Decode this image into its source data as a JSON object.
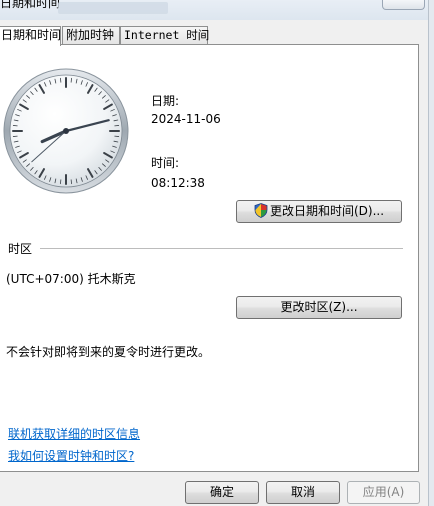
{
  "window": {
    "title": "日期和时间"
  },
  "tabs": [
    {
      "label": "日期和时间",
      "active": true
    },
    {
      "label": "附加时钟",
      "active": false
    },
    {
      "label": "Internet 时间",
      "active": false
    }
  ],
  "clock": {
    "time_shown": "08:12:38"
  },
  "date_section": {
    "date_label": "日期:",
    "date_value": "2024-11-06",
    "time_label": "时间:",
    "time_value": "08:12:38",
    "change_datetime_button": "更改日期和时间(D)..."
  },
  "timezone_section": {
    "header": "时区",
    "current_zone": "(UTC+07:00) 托木斯克",
    "change_zone_button": "更改时区(Z)...",
    "dst_note": "不会针对即将到来的夏令时进行更改。"
  },
  "links": {
    "online_info": "联机获取详细的时区信息",
    "how_to": "我如何设置时钟和时区?"
  },
  "footer": {
    "ok": "确定",
    "cancel": "取消",
    "apply": "应用(A)"
  },
  "icons": {
    "shield": "uac-shield-icon"
  }
}
